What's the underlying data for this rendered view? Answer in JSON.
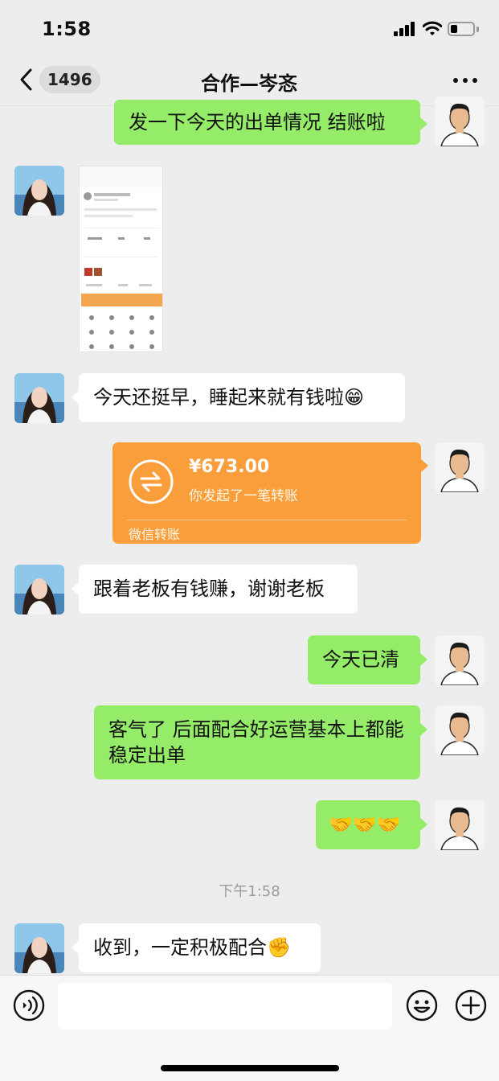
{
  "status": {
    "time": "1:58",
    "battery_level": 0.3
  },
  "nav": {
    "unread_count": "1496",
    "title": "合作—岑忞"
  },
  "messages": {
    "m1": "发一下今天的出单情况 结账啦",
    "m3": "今天还挺早，睡起来就有钱啦😁",
    "m5": "跟着老板有钱赚，谢谢老板",
    "m6": "今天已清",
    "m7": "客气了 后面配合好运营基本上都能稳定出单",
    "m8": "🤝🤝🤝",
    "m10": "收到，一定积极配合✊"
  },
  "transfer": {
    "amount": "¥673.00",
    "desc": "你发起了一笔转账",
    "brand": "微信转账"
  },
  "timestamp": "下午1:58",
  "icons": {
    "back": "chevron-left-icon",
    "more": "more-icon",
    "voice": "voice-icon",
    "emoji": "emoji-icon",
    "plus": "plus-icon",
    "transfer": "transfer-icon"
  },
  "colors": {
    "self_bubble": "#95ec69",
    "other_bubble": "#ffffff",
    "transfer_card": "#fa9d3b",
    "background": "#ededed"
  }
}
